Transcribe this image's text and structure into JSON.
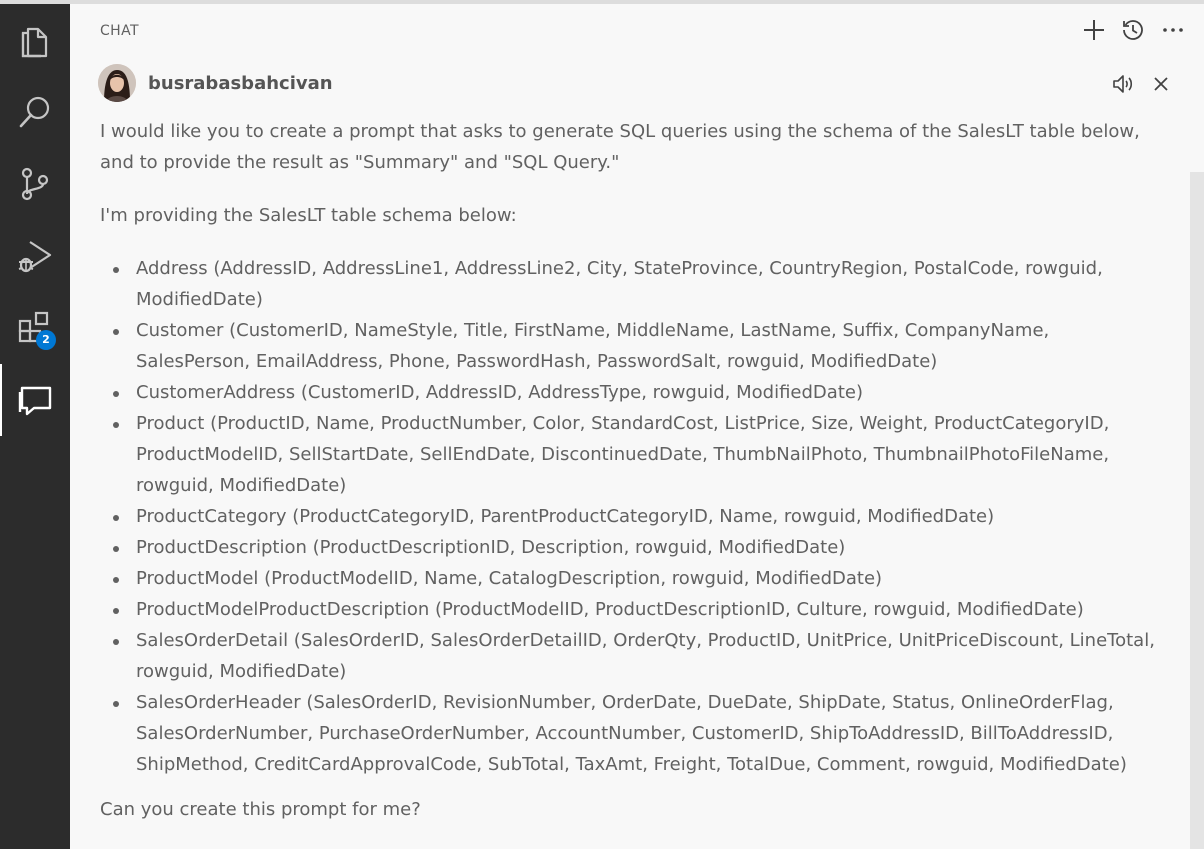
{
  "activity_bar": {
    "items": [
      {
        "icon": "files-icon"
      },
      {
        "icon": "search-icon"
      },
      {
        "icon": "source-control-icon"
      },
      {
        "icon": "run-debug-icon"
      },
      {
        "icon": "extensions-icon",
        "badge": "2"
      },
      {
        "icon": "chat-icon",
        "active": true
      }
    ]
  },
  "panel": {
    "title": "CHAT",
    "actions": [
      "new-chat-icon",
      "history-icon",
      "more-icon"
    ]
  },
  "message": {
    "user": "busrabasbahcivan",
    "actions": [
      "speaker-icon",
      "close-icon"
    ],
    "intro": "I would like you to create a prompt that asks to generate SQL queries using the schema of the SalesLT table below, and to provide the result as \"Summary\" and \"SQL Query.\"",
    "lead": "I'm providing the SalesLT table schema below:",
    "schema": [
      "Address (AddressID, AddressLine1, AddressLine2, City, StateProvince, CountryRegion, PostalCode, rowguid, ModifiedDate)",
      "Customer (CustomerID, NameStyle, Title, FirstName, MiddleName, LastName, Suffix, CompanyName, SalesPerson, EmailAddress, Phone, PasswordHash, PasswordSalt, rowguid, ModifiedDate)",
      "CustomerAddress (CustomerID, AddressID, AddressType, rowguid, ModifiedDate)",
      "Product (ProductID, Name, ProductNumber, Color, StandardCost, ListPrice, Size, Weight, ProductCategoryID, ProductModelID, SellStartDate, SellEndDate, DiscontinuedDate, ThumbNailPhoto, ThumbnailPhotoFileName, rowguid, ModifiedDate)",
      "ProductCategory (ProductCategoryID, ParentProductCategoryID, Name, rowguid, ModifiedDate)",
      "ProductDescription (ProductDescriptionID, Description, rowguid, ModifiedDate)",
      "ProductModel (ProductModelID, Name, CatalogDescription, rowguid, ModifiedDate)",
      "ProductModelProductDescription (ProductModelID, ProductDescriptionID, Culture, rowguid, ModifiedDate)",
      "SalesOrderDetail (SalesOrderID, SalesOrderDetailID, OrderQty, ProductID, UnitPrice, UnitPriceDiscount, LineTotal, rowguid, ModifiedDate)",
      "SalesOrderHeader (SalesOrderID, RevisionNumber, OrderDate, DueDate, ShipDate, Status, OnlineOrderFlag, SalesOrderNumber, PurchaseOrderNumber, AccountNumber, CustomerID, ShipToAddressID, BillToAddressID, ShipMethod, CreditCardApprovalCode, SubTotal, TaxAmt, Freight, TotalDue, Comment, rowguid, ModifiedDate)"
    ],
    "closing": "Can you create this prompt for me?"
  },
  "colors": {
    "activity_bar_bg": "#2c2c2c",
    "activity_icon": "#c5c5c5",
    "badge_bg": "#0078d4",
    "text": "#616161",
    "panel_bg": "#f8f8f8"
  }
}
